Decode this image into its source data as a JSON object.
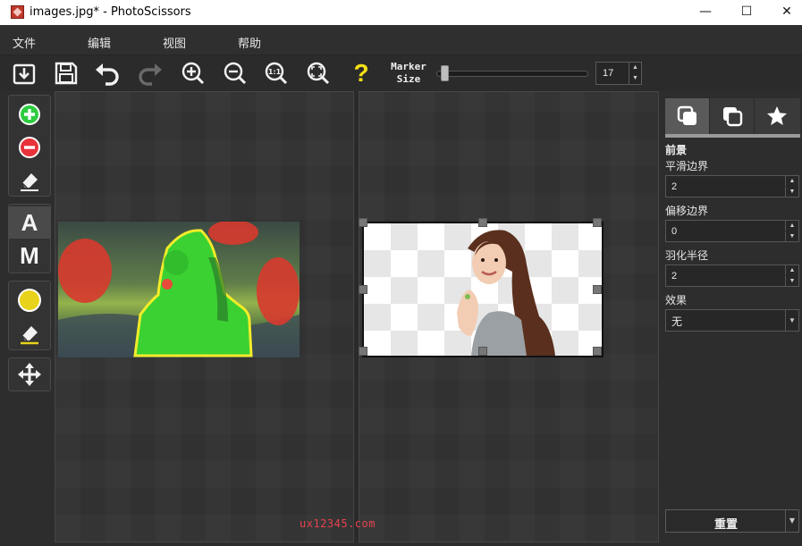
{
  "window": {
    "title": "images.jpg* - PhotoScissors",
    "minimize": "—",
    "maximize": "☐",
    "close": "✕"
  },
  "menu": [
    "文件",
    "编辑",
    "视图",
    "帮助"
  ],
  "toolbar": {
    "buttons": [
      "open-icon",
      "save-icon",
      "undo-icon",
      "redo-icon",
      "zoom-in-icon",
      "zoom-out-icon",
      "zoom-1to1-icon",
      "zoom-fit-icon",
      "help-icon"
    ],
    "marker_label_line1": "Marker",
    "marker_label_line2": "Size",
    "marker_size": "17",
    "marker_fraction": 0.03,
    "zoom_1to1_text": "1:1",
    "help_text": "?"
  },
  "left_tools": {
    "add_marker": "green-plus-icon",
    "remove_marker": "red-minus-icon",
    "eraser": "eraser-icon",
    "auto_mode": "A",
    "manual_mode": "M",
    "hair_marker": "yellow-dot-icon",
    "hair_eraser": "yellow-eraser-icon",
    "move": "move-icon"
  },
  "right_panel": {
    "tabs": [
      "foreground-tab-icon",
      "background-tab-icon",
      "star-tab-icon"
    ],
    "section_title": "前景",
    "smooth_label": "平滑边界",
    "smooth_value": "2",
    "offset_label": "偏移边界",
    "offset_value": "0",
    "feather_label": "羽化半径",
    "feather_value": "2",
    "effect_label": "效果",
    "effect_value": "无",
    "reset_label": "重置"
  },
  "watermark": "ux12345.com",
  "colors": {
    "add_marker": "#2ecc40",
    "remove_marker": "#e8323a",
    "hair_marker": "#e8d21a",
    "help": "#f4e016",
    "watermark": "#e8424f"
  }
}
